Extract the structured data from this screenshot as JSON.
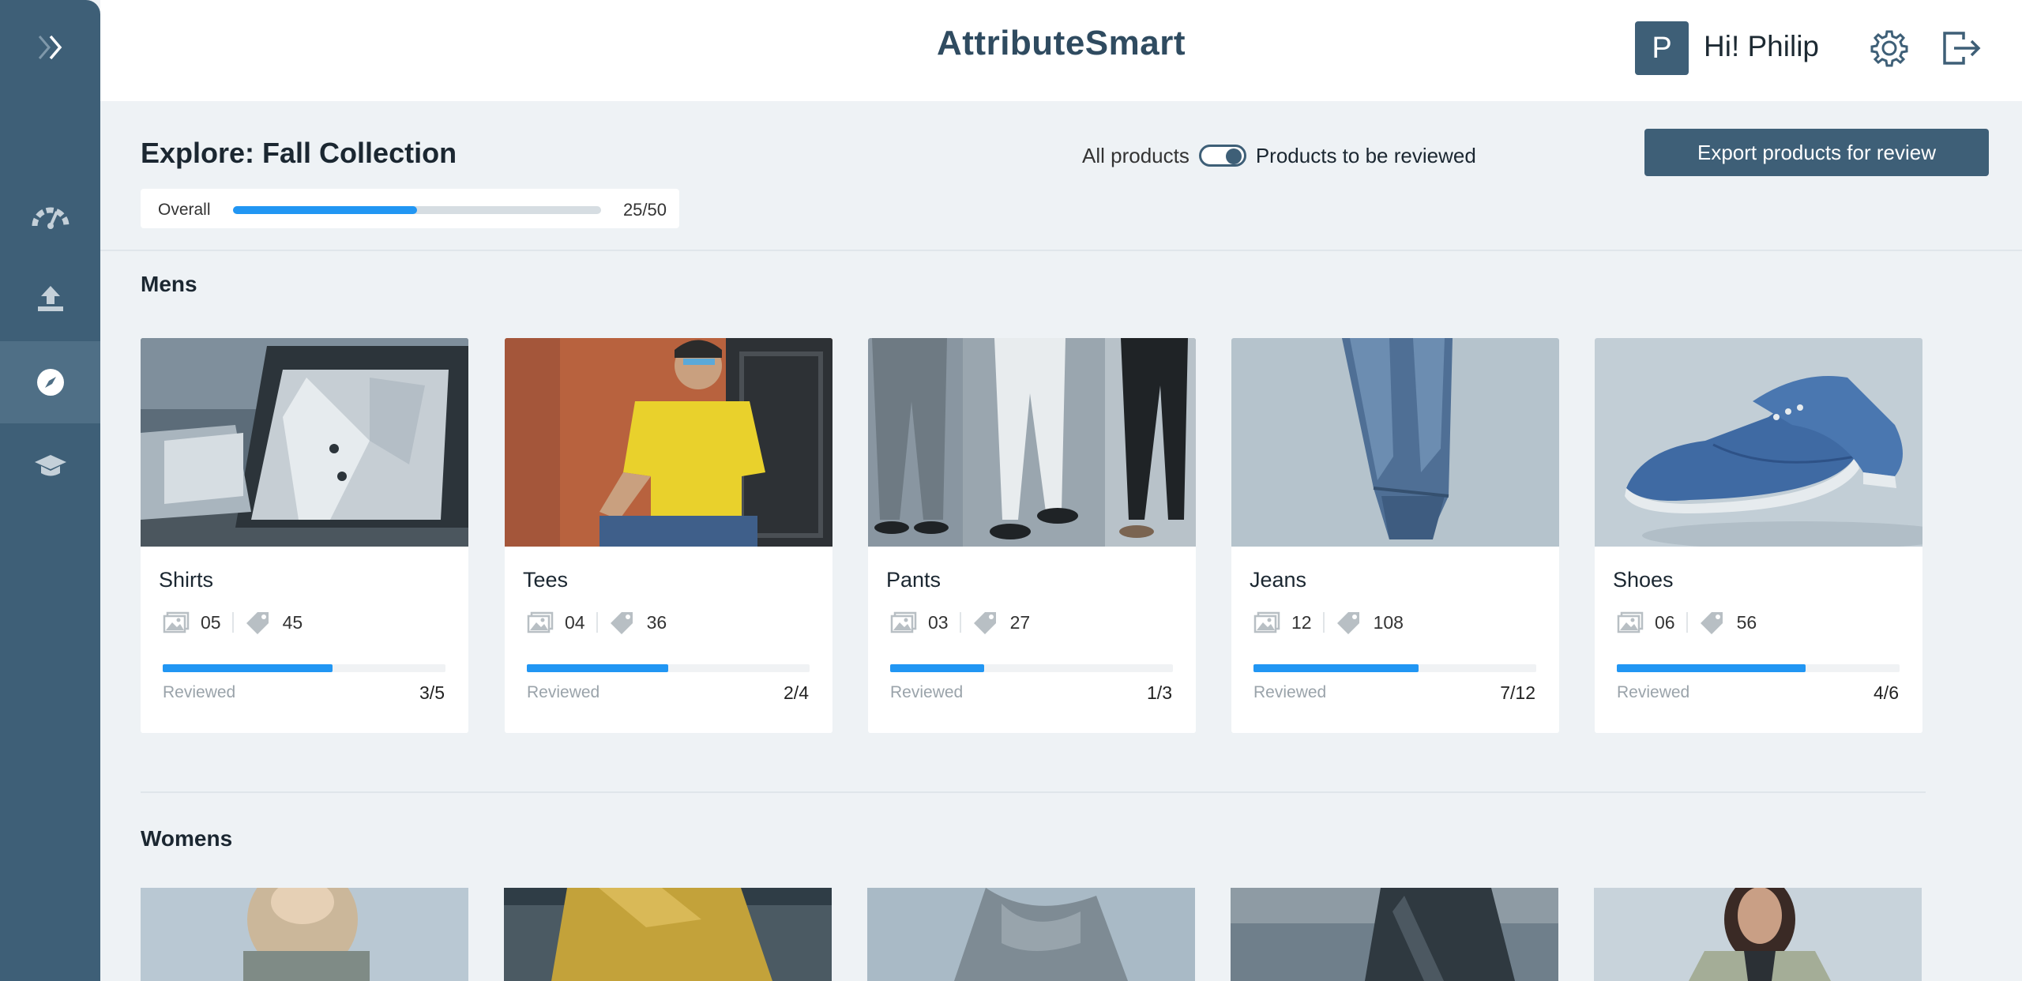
{
  "app": {
    "title": "AttributeSmart"
  },
  "user": {
    "initial": "P",
    "greeting": "Hi! Philip"
  },
  "page": {
    "title": "Explore: Fall Collection",
    "overall": {
      "label": "Overall",
      "count": "25/50",
      "progress": 0.5
    },
    "toggle": {
      "left_label": "All products",
      "right_label": "Products to be reviewed",
      "on": true
    },
    "export_label": "Export products for review"
  },
  "sidebar": {
    "items": [
      {
        "icon": "dashboard-gauge-icon",
        "active": false
      },
      {
        "icon": "upload-icon",
        "active": false
      },
      {
        "icon": "compass-icon",
        "active": true
      },
      {
        "icon": "graduation-cap-icon",
        "active": false
      }
    ]
  },
  "mens": {
    "title": "Mens",
    "cards": [
      {
        "name": "Shirts",
        "images": "05",
        "tags": "45",
        "reviewed_label": "Reviewed",
        "count": "3/5",
        "progress": 0.6
      },
      {
        "name": "Tees",
        "images": "04",
        "tags": "36",
        "reviewed_label": "Reviewed",
        "count": "2/4",
        "progress": 0.5
      },
      {
        "name": "Pants",
        "images": "03",
        "tags": "27",
        "reviewed_label": "Reviewed",
        "count": "1/3",
        "progress": 0.333
      },
      {
        "name": "Jeans",
        "images": "12",
        "tags": "108",
        "reviewed_label": "Reviewed",
        "count": "7/12",
        "progress": 0.583
      },
      {
        "name": "Shoes",
        "images": "06",
        "tags": "56",
        "reviewed_label": "Reviewed",
        "count": "4/6",
        "progress": 0.667
      }
    ]
  },
  "womens": {
    "title": "Womens"
  },
  "colors": {
    "brand": "#3e5f77",
    "accent": "#2196f3",
    "background": "#eef2f5"
  }
}
